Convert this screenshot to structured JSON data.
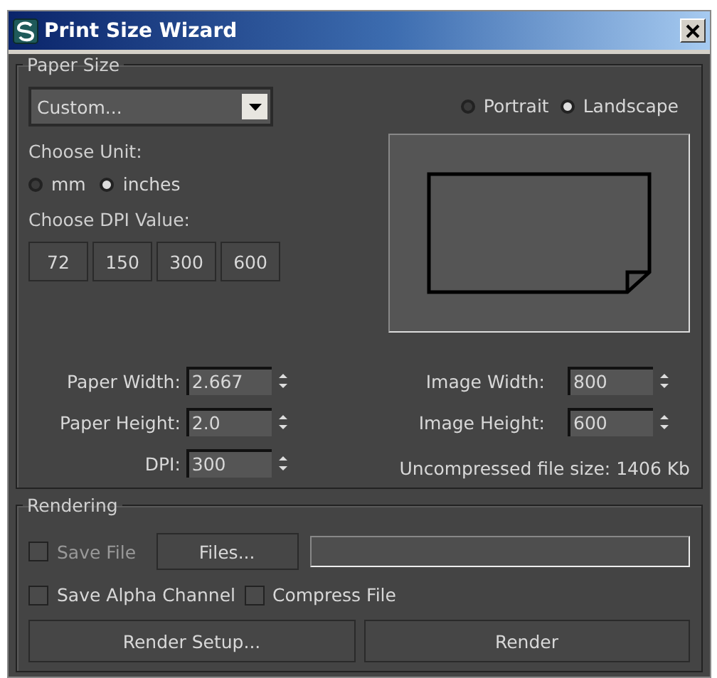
{
  "window": {
    "title": "Print Size Wizard"
  },
  "paper_size": {
    "legend": "Paper Size",
    "dropdown": "Custom...",
    "unit_label": "Choose Unit:",
    "units": [
      {
        "label": "mm",
        "selected": false
      },
      {
        "label": "inches",
        "selected": true
      }
    ],
    "dpi_label": "Choose DPI Value:",
    "dpi_presets": [
      "72",
      "150",
      "300",
      "600"
    ],
    "orientations": [
      {
        "label": "Portrait",
        "selected": false
      },
      {
        "label": "Landscape",
        "selected": true
      }
    ],
    "paper_fields": [
      {
        "label": "Paper Width:",
        "value": "2.667"
      },
      {
        "label": "Paper Height:",
        "value": "2.0"
      },
      {
        "label": "DPI:",
        "value": "300"
      }
    ],
    "image_fields": [
      {
        "label": "Image Width:",
        "value": "800"
      },
      {
        "label": "Image Height:",
        "value": "600"
      }
    ],
    "file_size": "Uncompressed file size: 1406 Kb"
  },
  "rendering": {
    "legend": "Rendering",
    "files_button": "Files...",
    "checkboxes": [
      {
        "label": "Save File",
        "checked": false,
        "disabled": true
      },
      {
        "label": "Save Alpha Channel",
        "checked": false,
        "disabled": false
      },
      {
        "label": "Compress File",
        "checked": false,
        "disabled": false
      }
    ],
    "buttons": [
      "Render Setup...",
      "Render"
    ]
  }
}
